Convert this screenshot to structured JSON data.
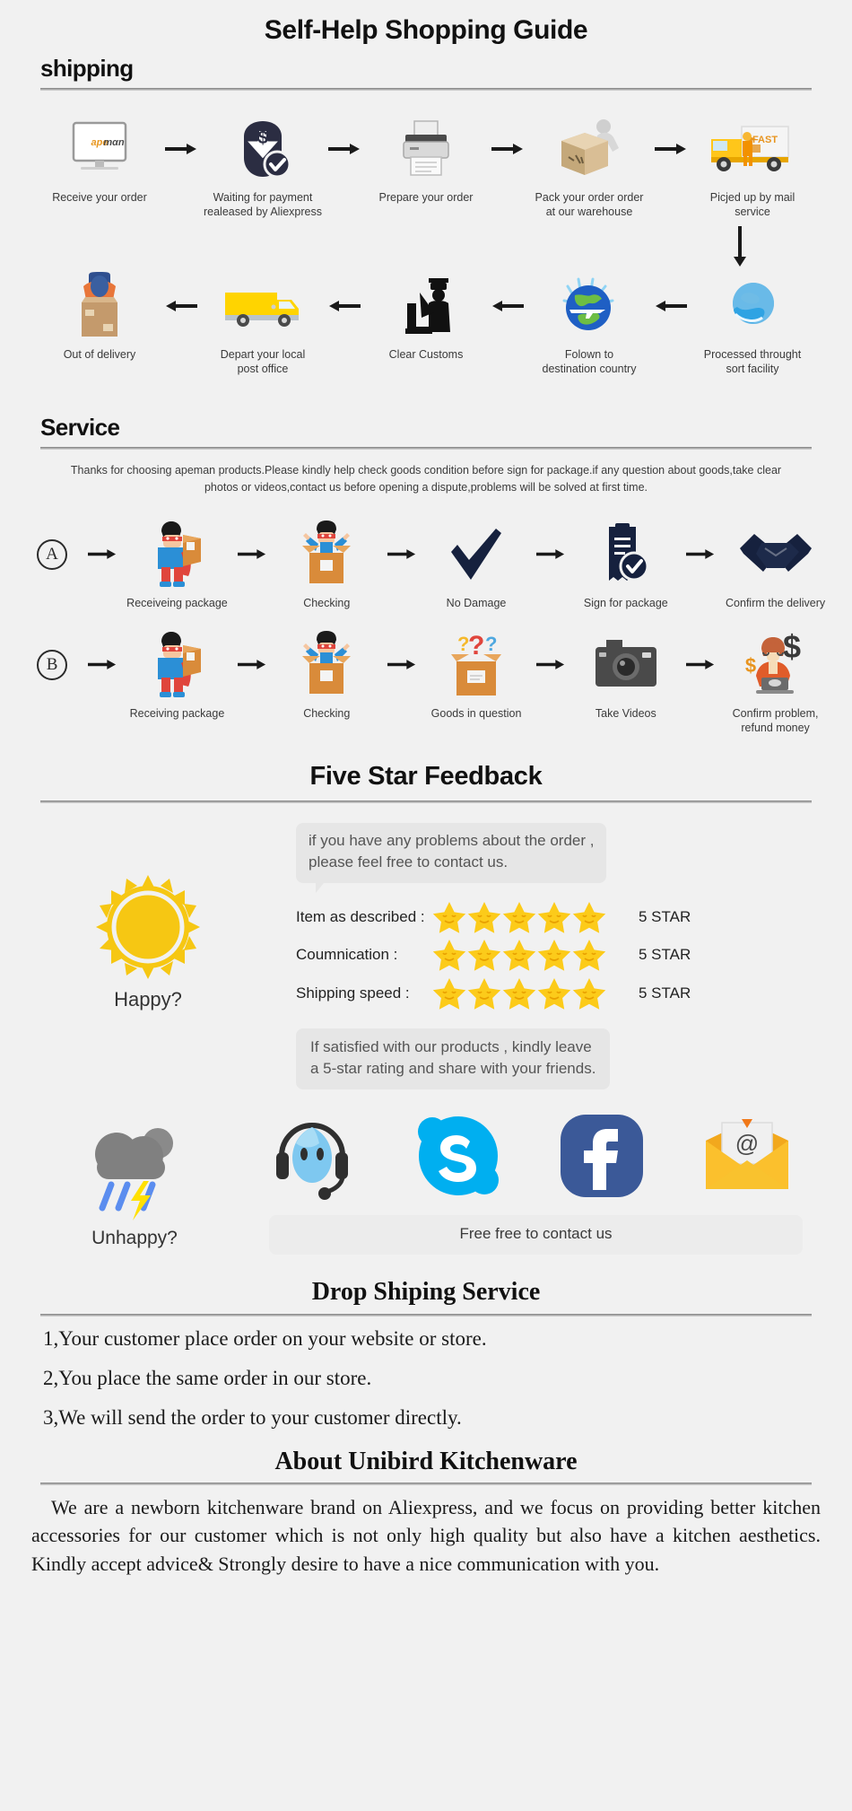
{
  "page": {
    "title": "Self-Help Shopping Guide",
    "background": "#f1f1f1"
  },
  "shipping": {
    "heading": "shipping",
    "row1": [
      {
        "icon": "monitor-apeman-icon",
        "caption": "Receive your order"
      },
      {
        "icon": "payment-dollar-shield-icon",
        "caption": "Waiting for payment\nrealeased by Aliexpress"
      },
      {
        "icon": "printer-icon",
        "caption": "Prepare your order"
      },
      {
        "icon": "worker-packing-box-icon",
        "caption": "Pack your order order\nat our warehouse"
      },
      {
        "icon": "fast-delivery-truck-icon",
        "caption": "Picjed up by mail service"
      }
    ],
    "row2": [
      {
        "icon": "delivery-man-box-icon",
        "caption": "Out of delivery"
      },
      {
        "icon": "yellow-van-icon",
        "caption": "Depart your local\npost office"
      },
      {
        "icon": "customs-officer-icon",
        "caption": "Clear Customs"
      },
      {
        "icon": "globe-airplane-icon",
        "caption": "Folown to\ndestination country"
      },
      {
        "icon": "blue-globe-sort-icon",
        "caption": "Processed throught\nsort facility"
      }
    ]
  },
  "service": {
    "heading": "Service",
    "note": "Thanks for choosing apeman products.Please kindly help check goods condition before sign for package.if any question about goods,take clear photos or videos,contact us before opening a dispute,problems will be solved at first time.",
    "row_a": {
      "letter": "A",
      "steps": [
        {
          "icon": "hero-holding-package-icon",
          "caption": "Receiveing package"
        },
        {
          "icon": "hero-opening-box-icon",
          "caption": "Checking"
        },
        {
          "icon": "checkmark-icon",
          "caption": "No Damage"
        },
        {
          "icon": "sign-document-icon",
          "caption": "Sign for package"
        },
        {
          "icon": "handshake-icon",
          "caption": "Confirm the delivery"
        }
      ]
    },
    "row_b": {
      "letter": "B",
      "steps": [
        {
          "icon": "hero-holding-package-icon",
          "caption": "Receiving package"
        },
        {
          "icon": "hero-opening-box-icon",
          "caption": "Checking"
        },
        {
          "icon": "box-question-marks-icon",
          "caption": "Goods in question"
        },
        {
          "icon": "camera-icon",
          "caption": "Take Videos"
        },
        {
          "icon": "agent-refund-icon",
          "caption": "Confirm problem,\nrefund money"
        }
      ]
    }
  },
  "feedback": {
    "heading": "Five Star Feedback",
    "happy_label": "Happy?",
    "bubble_top": "if you have any problems about the order ,\nplease feel free to contact us.",
    "ratings": [
      {
        "label": "Item as described :",
        "stars": 5,
        "value": "5 STAR"
      },
      {
        "label": "Coumnication :",
        "stars": 5,
        "value": "5 STAR"
      },
      {
        "label": "Shipping speed :",
        "stars": 5,
        "value": "5 STAR"
      }
    ],
    "bubble_bottom": "If satisfied with our products ,  kindly leave\na 5-star rating and share with your friends.",
    "unhappy_label": "Unhappy?",
    "social_icons": [
      "headset-support-icon",
      "skype-icon",
      "facebook-icon",
      "email-at-envelope-icon"
    ],
    "contact_bar": "Free free to contact us",
    "colors": {
      "sun": "#F6C713",
      "star": "#FCCB1A",
      "skype": "#00AFF0",
      "facebook": "#3B5998",
      "envelope": "#F9C22E",
      "cloud": "#808080",
      "rain": "#5B8DEF",
      "lightning": "#FFE000"
    }
  },
  "dropshipping": {
    "heading": "Drop Shiping Service",
    "items": [
      "1,Your customer place order on your website or store.",
      "2,You place the same order in our store.",
      "3,We will send the order to your customer directly."
    ]
  },
  "about": {
    "heading": "About Unibird Kitchenware",
    "body": "We are a newborn kitchenware brand on Aliexpress, and we focus on providing better kitchen accessories for our customer which is not only high quality but also have a kitchen aesthetics. Kindly accept advice& Strongly desire to have a nice communication with you."
  }
}
